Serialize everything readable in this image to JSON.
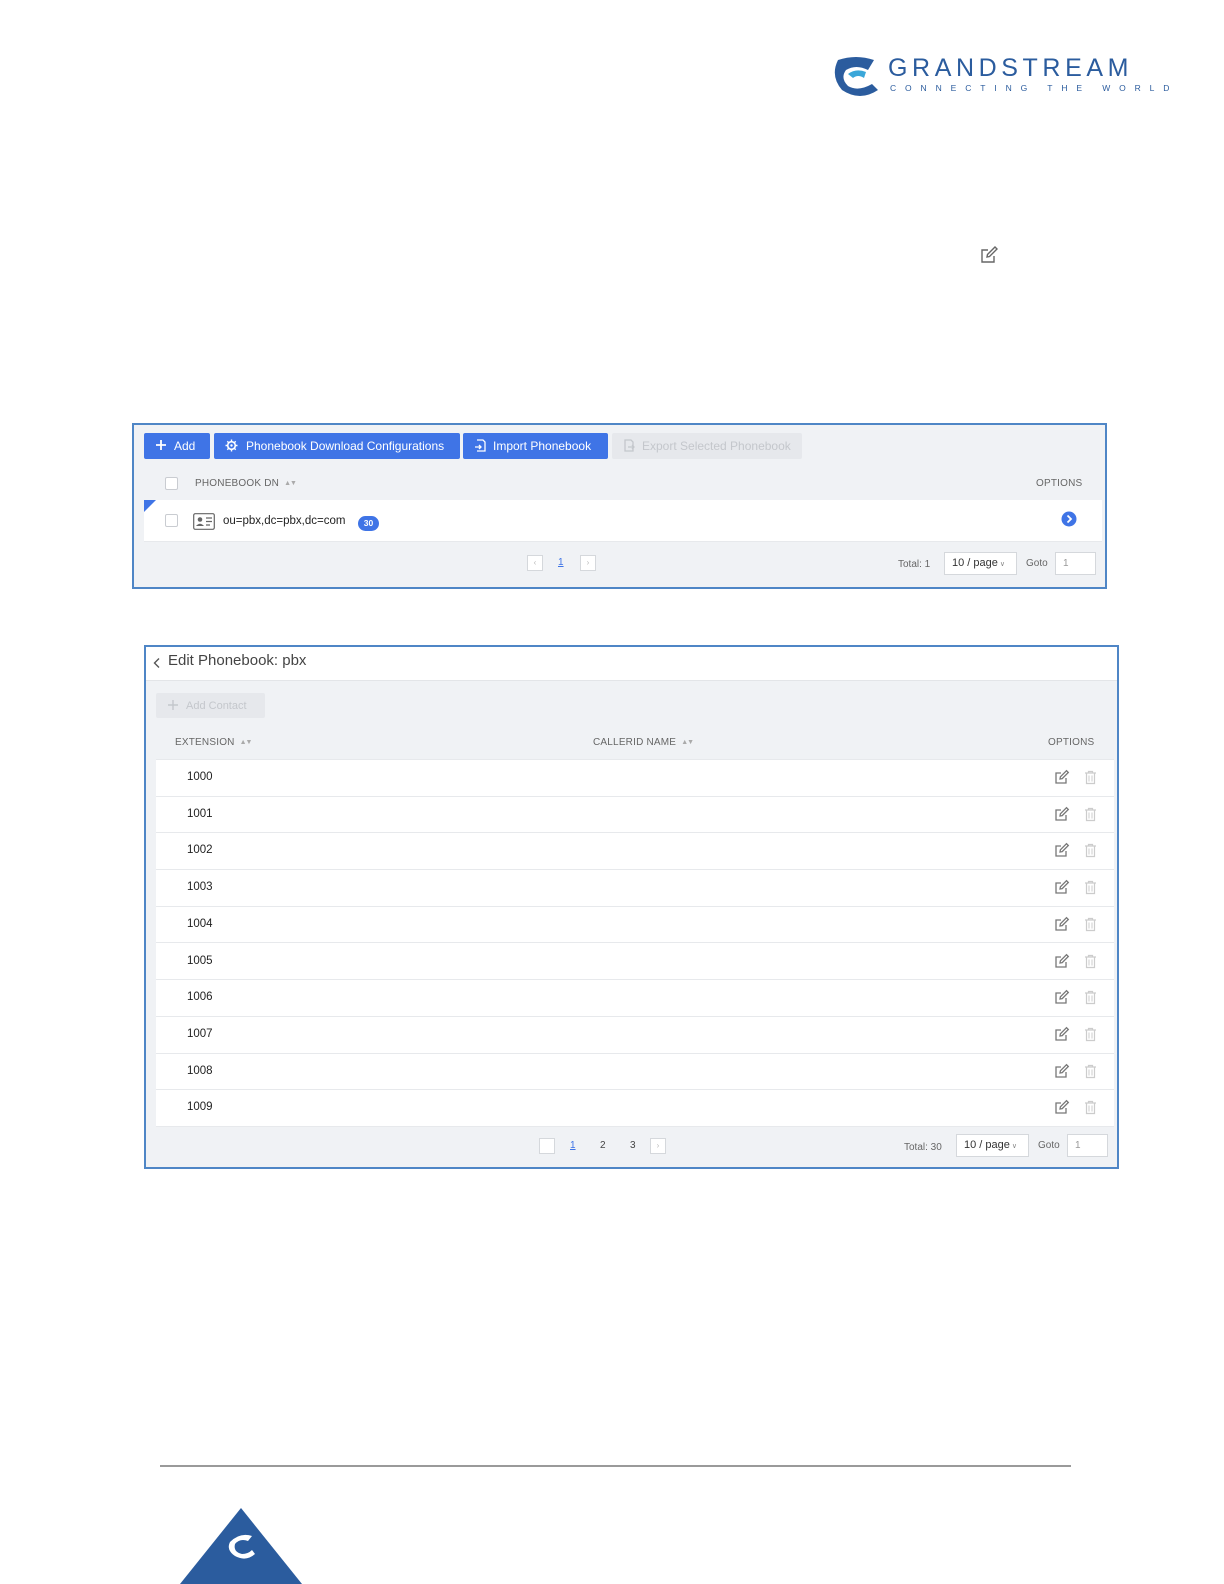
{
  "logo": {
    "wordmark": "GRANDSTREAM",
    "tagline": "CONNECTING THE WORLD"
  },
  "colors": {
    "accent": "#3f74e6",
    "frame_border": "#4f86c6",
    "brand": "#2b5c9e"
  },
  "phonebook_list": {
    "toolbar": {
      "add_label": "Add",
      "download_config_label": "Phonebook Download Configurations",
      "import_label": "Import Phonebook",
      "export_label": "Export Selected Phonebook"
    },
    "columns": {
      "dn": "PHONEBOOK DN",
      "options": "OPTIONS"
    },
    "rows": [
      {
        "dn": "ou=pbx,dc=pbx,dc=com",
        "count": "30"
      }
    ],
    "pagination": {
      "current_page": "1",
      "total": "Total: 1",
      "page_size": "10 / page",
      "goto_label": "Goto",
      "goto_value": "1"
    }
  },
  "edit_phonebook": {
    "title": "Edit Phonebook: pbx",
    "add_contact_label": "Add Contact",
    "columns": {
      "extension": "EXTENSION",
      "callerid": "CALLERID NAME",
      "options": "OPTIONS"
    },
    "rows": [
      {
        "extension": "1000",
        "callerid": ""
      },
      {
        "extension": "1001",
        "callerid": ""
      },
      {
        "extension": "1002",
        "callerid": ""
      },
      {
        "extension": "1003",
        "callerid": ""
      },
      {
        "extension": "1004",
        "callerid": ""
      },
      {
        "extension": "1005",
        "callerid": ""
      },
      {
        "extension": "1006",
        "callerid": ""
      },
      {
        "extension": "1007",
        "callerid": ""
      },
      {
        "extension": "1008",
        "callerid": ""
      },
      {
        "extension": "1009",
        "callerid": ""
      }
    ],
    "pagination": {
      "pages": [
        "1",
        "2",
        "3"
      ],
      "current_page": "1",
      "total": "Total: 30",
      "page_size": "10 / page",
      "goto_label": "Goto",
      "goto_value": "1"
    }
  }
}
